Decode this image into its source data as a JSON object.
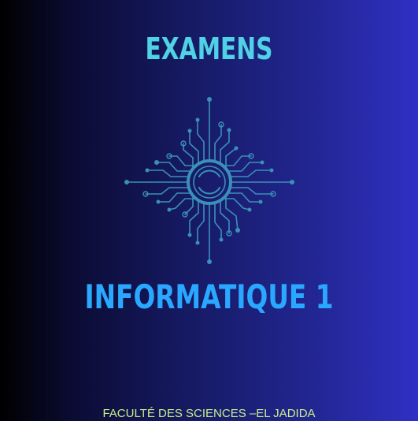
{
  "cover": {
    "heading": "EXAMENS",
    "subject": "INFORMATIQUE 1",
    "institution": "FACULTÉ DES SCIENCES –EL JADIDA"
  },
  "emblem": {
    "icon": "circuit-chip-icon",
    "color": "#3a90b8"
  },
  "colors": {
    "heading": "#4fd1e6",
    "subject": "#2aa8ff",
    "footer": "#c8f08a",
    "background_left": "#000000",
    "background_right": "#2f30c4"
  }
}
